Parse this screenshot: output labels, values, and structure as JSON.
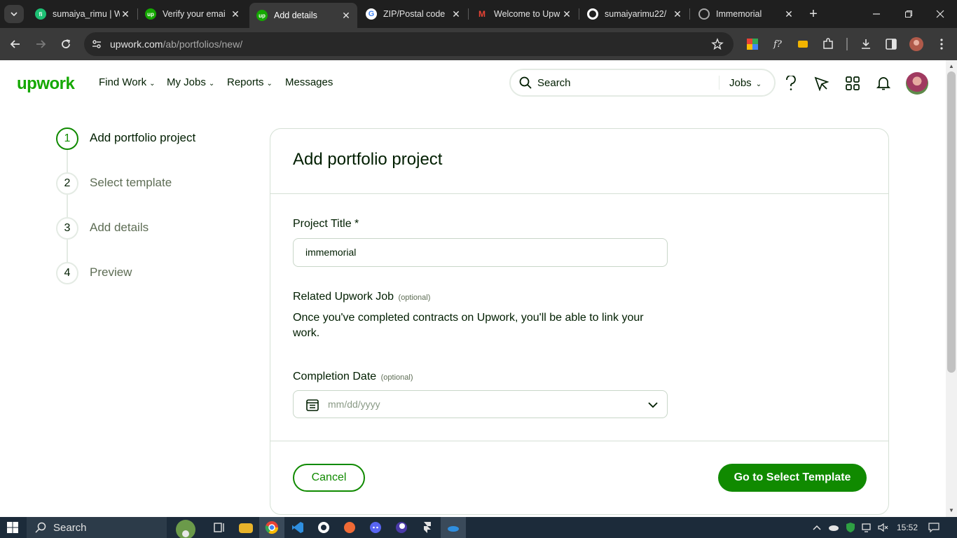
{
  "browser": {
    "tabs": [
      {
        "title": "sumaiya_rimu | W",
        "favicon": "fiverr-icon",
        "color": "#1dbf73",
        "fav_text": "fi"
      },
      {
        "title": "Verify your emai",
        "favicon": "upwork-icon",
        "color": "#14a800",
        "fav_text": "up"
      },
      {
        "title": "Add details",
        "favicon": "upwork-icon",
        "color": "#14a800",
        "fav_text": "up"
      },
      {
        "title": "ZIP/Postal code",
        "favicon": "google-icon",
        "color": "#ffffff",
        "fav_text": "G"
      },
      {
        "title": "Welcome to Upw",
        "favicon": "gmail-icon",
        "color": "#ffffff",
        "fav_text": "M"
      },
      {
        "title": "sumaiyarimu22/",
        "favicon": "github-icon",
        "color": "#ffffff",
        "fav_text": ""
      },
      {
        "title": "Immemorial",
        "favicon": "globe-icon",
        "color": "#8a8a8a",
        "fav_text": ""
      }
    ],
    "active_tab_index": 2,
    "url_domain": "upwork.com",
    "url_path": "/ab/portfolios/new/"
  },
  "header": {
    "logo": "upwork",
    "nav": [
      "Find Work",
      "My Jobs",
      "Reports",
      "Messages"
    ],
    "search_placeholder": "Search",
    "search_scope": "Jobs"
  },
  "steps": [
    {
      "num": "1",
      "label": "Add portfolio project",
      "active": true
    },
    {
      "num": "2",
      "label": "Select template",
      "active": false
    },
    {
      "num": "3",
      "label": "Add details",
      "active": false
    },
    {
      "num": "4",
      "label": "Preview",
      "active": false
    }
  ],
  "form": {
    "heading": "Add portfolio project",
    "title_label": "Project Title *",
    "title_value": "immemorial",
    "related_label": "Related Upwork Job",
    "optional": "(optional)",
    "related_help": "Once you've completed contracts on Upwork, you'll be able to link your work.",
    "date_label": "Completion Date",
    "date_placeholder": "mm/dd/yyyy",
    "cancel": "Cancel",
    "next": "Go to Select Template"
  },
  "taskbar": {
    "search_label": "Search",
    "time": "15:52"
  },
  "colors": {
    "brand_green": "#14a800",
    "button_green": "#108a00"
  }
}
